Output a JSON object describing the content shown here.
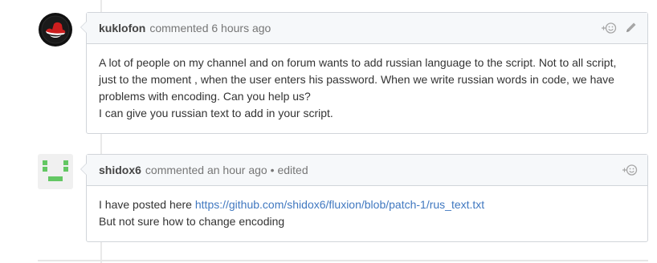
{
  "comments": [
    {
      "author": "kuklofon",
      "meta": "commented 6 hours ago",
      "reaction_icon": "smiley-add-icon",
      "edit_icon": "pencil-icon",
      "body_lines": [
        "A lot of people on my channel and on forum wants to add russian language to the script. Not to all script, just to the moment , when the user enters his password. When we write russian words in code, we have problems with encoding. Can you help us?",
        "I can give you russian text to add in your script."
      ]
    },
    {
      "author": "shidox6",
      "meta": "commented an hour ago",
      "edited": "• edited",
      "reaction_icon": "smiley-add-icon",
      "body_prefix": "I have posted here ",
      "link_text": "https://github.com/shidox6/fluxion/blob/patch-1/rus_text.txt",
      "body_line2": "But not sure how to change encoding"
    }
  ],
  "colors": {
    "link": "#4078c0",
    "header_bg": "#f6f8fa",
    "border": "#d1d5da",
    "identicon": "#63c763"
  }
}
